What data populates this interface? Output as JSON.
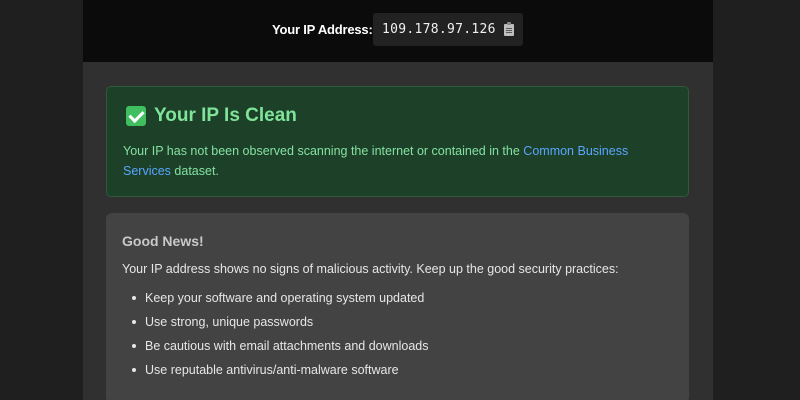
{
  "header": {
    "ip_label": "Your IP Address:",
    "ip_value": "109.178.97.126",
    "copy_icon": "clipboard-icon"
  },
  "status_card": {
    "icon": "check-mark-icon",
    "title": "Your IP Is Clean",
    "text_before_link": "Your IP has not been observed scanning the internet or contained in the ",
    "link_text": "Common Business Services",
    "text_after_link": " dataset.",
    "colors": {
      "background": "#1d4028",
      "title": "#7fe39a",
      "link": "#58a6ff"
    }
  },
  "news_card": {
    "title": "Good News!",
    "intro": "Your IP address shows no signs of malicious activity. Keep up the good security practices:",
    "tips": [
      "Keep your software and operating system updated",
      "Use strong, unique passwords",
      "Be cautious with email attachments and downloads",
      "Use reputable antivirus/anti-malware software"
    ]
  }
}
